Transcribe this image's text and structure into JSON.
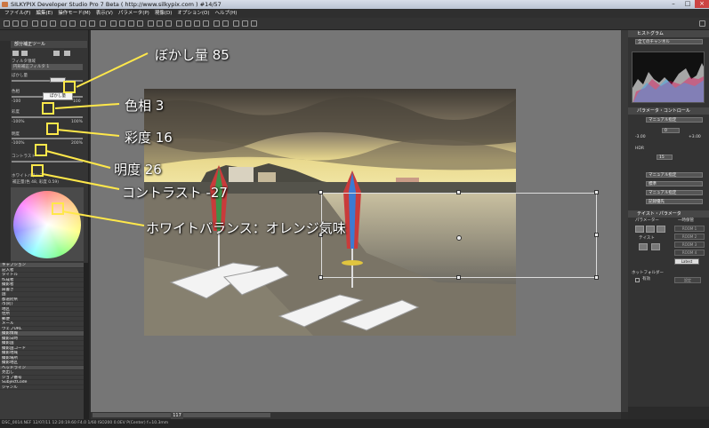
{
  "titlebar": {
    "title": "SILKYPIX Developer Studio Pro 7 Beta ( http://www.silkypix.com )  #14/57"
  },
  "menubar": {
    "items": [
      "ファイル(F)",
      "編集(E)",
      "操作モード(M)",
      "表示(V)",
      "パラメータ(P)",
      "現像(D)",
      "オプション(O)",
      "ヘルプ(H)"
    ]
  },
  "left_panel": {
    "header": "部分補正ツール",
    "filter_label": "フィルタ領域",
    "filter_value": "円形補正フィルタ 1",
    "blur_label": "ぼかし量",
    "blur_value": "85",
    "hue_label": "色相",
    "hue_value": "3",
    "hue_min": "-100",
    "hue_max": "100",
    "sat_label": "彩度",
    "sat_value": "16",
    "sat_min": "-100%",
    "sat_max": "100%",
    "bright_label": "明度",
    "bright_value": "26",
    "bright_min": "-100%",
    "bright_max": "200%",
    "contrast_label": "コントラスト",
    "contrast_value": "-27",
    "wb_label": "ホワイトバランス",
    "wb_readout": "補正量(色  48, 彩度  0.59)",
    "tooltip": "ぼかし量",
    "list_items": [
      {
        "label": "キャプション",
        "section": true
      },
      {
        "label": "記入者",
        "section": false
      },
      {
        "label": "タイトル",
        "section": false
      },
      {
        "label": "作成者",
        "section": false
      },
      {
        "label": "撮影者",
        "section": false
      },
      {
        "label": "肩書き",
        "section": false
      },
      {
        "label": "国",
        "section": false
      },
      {
        "label": "都道府県",
        "section": false
      },
      {
        "label": "市(町)",
        "section": false
      },
      {
        "label": "地区",
        "section": false
      },
      {
        "label": "住所",
        "section": false
      },
      {
        "label": "郵便",
        "section": false
      },
      {
        "label": "メール",
        "section": false
      },
      {
        "label": "ウェブURL",
        "section": false
      },
      {
        "label": "撮影情報",
        "section": true
      },
      {
        "label": "撮影日時",
        "section": false
      },
      {
        "label": "撮影国",
        "section": false
      },
      {
        "label": "撮影国コード",
        "section": false
      },
      {
        "label": "撮影地域",
        "section": false
      },
      {
        "label": "撮影場所",
        "section": false
      },
      {
        "label": "撮影地区",
        "section": false
      },
      {
        "label": "ヘッドライン",
        "section": true
      },
      {
        "label": "見出し",
        "section": false
      },
      {
        "label": "ジョブ番号",
        "section": false
      },
      {
        "label": "SubjectCode",
        "section": false
      },
      {
        "label": "ジャンル",
        "section": false
      }
    ]
  },
  "main": {
    "zoom": "117"
  },
  "right_panel": {
    "histogram_title": "ヒストグラム",
    "histogram_channel": "全てのチャンネル",
    "param_title": "パラメータ・コントロール",
    "wb_mode": "マニュアル指定",
    "exposure_value": "0",
    "exp_min": "-3.00",
    "exp_max": "+3.00",
    "hdr_label": "HDR",
    "hdr_value": "15",
    "tone_mode": "マニュアル指定",
    "tone_name": "標準",
    "sharp_mode": "マニュアル指定",
    "noise_mode": "記録優先",
    "taste_title": "テイスト・パラメータ",
    "param_group": "パラメーター",
    "taste_group": "テイスト",
    "memory_group": "一時保管",
    "rooms": [
      "ROOM 1",
      "ROOM 2",
      "ROOM 3",
      "ROOM 4"
    ],
    "latest": "Latest",
    "hot_folder_title": "ホットフォルダー",
    "hot_folder_enable": "有効",
    "hot_folder_btn": "設定"
  },
  "status": {
    "text": "DSC_0014.NEF 12/07/11 12:20:19.60 F4.0 1/60 ISO200  0.0EV P(Center) f=10.3mm"
  },
  "callouts": [
    {
      "label": "ぼかし量 85"
    },
    {
      "label": "色相 3"
    },
    {
      "label": "彩度 16"
    },
    {
      "label": "明度 26"
    },
    {
      "label": "コントラスト -27"
    },
    {
      "label": "ホワイトバランス：オレンジ気味"
    }
  ],
  "colors": {
    "callout": "#ffe84a",
    "workspace": "#767676",
    "panel": "#353535"
  }
}
